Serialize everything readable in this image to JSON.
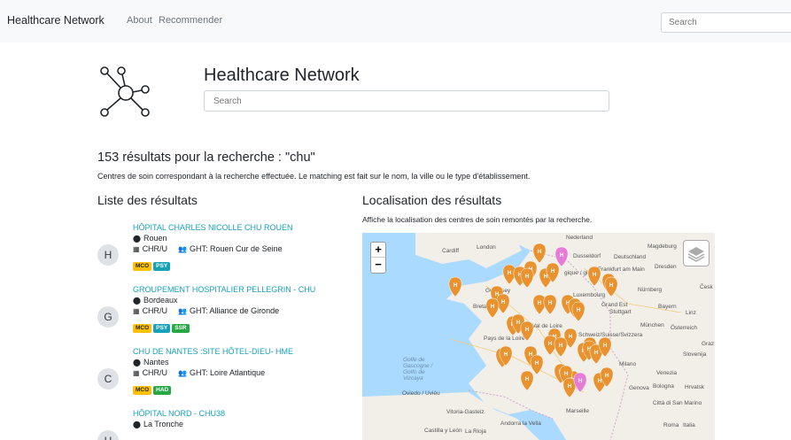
{
  "navbar": {
    "brand": "Healthcare Network",
    "links": [
      "About",
      "Recommender"
    ],
    "search_placeholder": "Search"
  },
  "hero": {
    "title": "Healthcare Network",
    "search_placeholder": "Search",
    "logo_icon": "network-graph-icon"
  },
  "results": {
    "title": "153 résultats pour la recherche : \"chu\"",
    "description": "Centres de soin correspondant à la recherche effectuée. Le matching est fait sur le nom, la ville ou le type d'établissement."
  },
  "list": {
    "heading": "Liste des résultats",
    "items": [
      {
        "initial": "H",
        "name": "HÔPITAL CHARLES NICOLLE CHU ROUEN",
        "city": "Rouen",
        "type": "CHR/U",
        "ght": "GHT: Rouen Cur de Seine",
        "tags": [
          "MCO",
          "PSY"
        ]
      },
      {
        "initial": "G",
        "name": "GROUPEMENT HOSPITALIER PELLEGRIN - CHU",
        "city": "Bordeaux",
        "type": "CHR/U",
        "ght": "GHT: Alliance de Gironde",
        "tags": [
          "MCO",
          "PSY",
          "SSR"
        ]
      },
      {
        "initial": "C",
        "name": "CHU DE NANTES :SITE HÔTEL-DIEU- HME",
        "city": "Nantes",
        "type": "CHR/U",
        "ght": "GHT: Loire Atlantique",
        "tags": [
          "MCO",
          "HAD"
        ]
      },
      {
        "initial": "H",
        "name": "HÔPITAL NORD - CHU38",
        "city": "La Tronche",
        "type": "",
        "ght": "",
        "tags": []
      }
    ]
  },
  "map": {
    "heading": "Localisation des résultats",
    "description": "Affiche la localisation des centres de soin remontés par la recherche.",
    "zoom_in": "+",
    "zoom_out": "−",
    "labels": [
      "Cardiff",
      "London",
      "Nederland",
      "Magdeburg",
      "Dusseldorf",
      "Deutschland",
      "Dresden",
      "Frankfurt am Main",
      "Guernsey",
      "Luxembourg",
      "Nürnberg",
      "Česk",
      "Stuttgart",
      "Bayern",
      "Linz",
      "München",
      "Österreich",
      "Schweiz/Suisse/Svizzera",
      "Graz",
      "Slovenija",
      "Milano",
      "Venezia",
      "Bologna",
      "Hrvatsk",
      "Genova",
      "Città di San Marino",
      "Marseille",
      "Roma",
      "Italia",
      "Oviedo / Uviéu",
      "Vitoria-Gasteiz",
      "Castilla y León",
      "La Rioja",
      "Andorra la Vella",
      "Golfe de Gascogne / Golfo de Vizcaya",
      "Grand Est",
      "Centre-Val de Loire",
      "Pays de la Loire",
      "Bretagne",
      "gique / gië"
    ],
    "marker_colors": {
      "hospital": "#e8932f",
      "special": "#e87bd6"
    },
    "marker_letter": "H"
  }
}
